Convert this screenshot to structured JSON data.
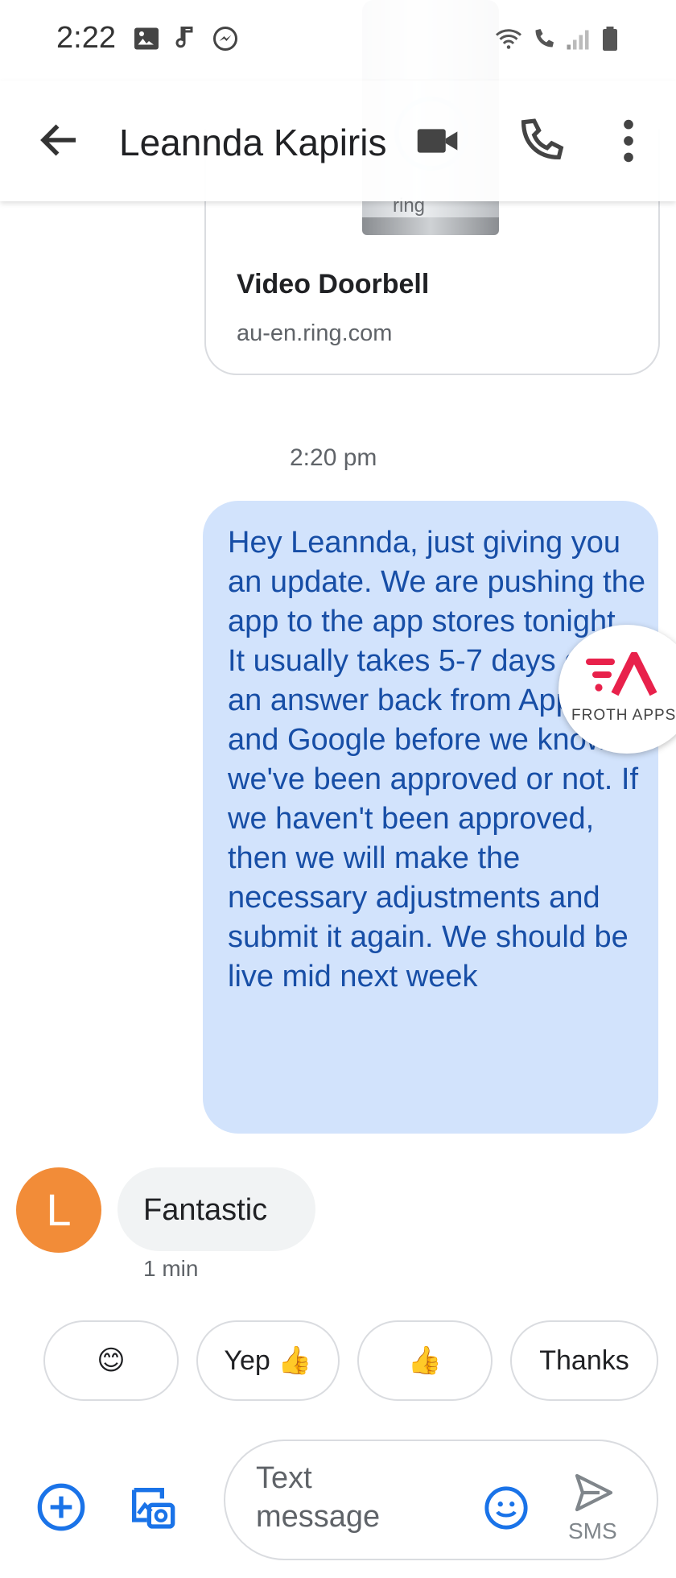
{
  "status_bar": {
    "time": "2:22",
    "icons": [
      "image-icon",
      "music-note-icon",
      "messenger-icon",
      "wifi-icon",
      "wifi-calling-icon",
      "signal-icon",
      "battery-icon"
    ]
  },
  "header": {
    "contact_name": "Leannda Kapiris",
    "actions": [
      "video-call-icon",
      "phone-icon",
      "more-options-icon"
    ]
  },
  "conversation": {
    "link_preview": {
      "title": "Video Doorbell",
      "domain": "au-en.ring.com",
      "product_mark": "ring"
    },
    "timestamp": "2:20 pm",
    "outgoing_message": "Hey Leannda, just giving you an update. We are pushing the app to the app stores tonight. It usually takes 5-7 days get an answer back from Apple and Google before we know if we've been approved or not. If we haven't been approved, then we will make the necessary adjustments and submit it again. We should be live mid next week",
    "overlay_badge": "FROTH APPS",
    "incoming": {
      "avatar_letter": "L",
      "text": "Fantastic",
      "time": "1 min"
    }
  },
  "smart_replies": [
    "😊",
    "Yep 👍",
    "👍",
    "Thanks"
  ],
  "compose": {
    "placeholder": "Text message",
    "send_label": "SMS"
  },
  "colors": {
    "outgoing_bubble": "#d2e3fc",
    "outgoing_text": "#174ea6",
    "avatar": "#f28c38",
    "accent": "#1a73e8",
    "froth_red": "#e8214b"
  }
}
